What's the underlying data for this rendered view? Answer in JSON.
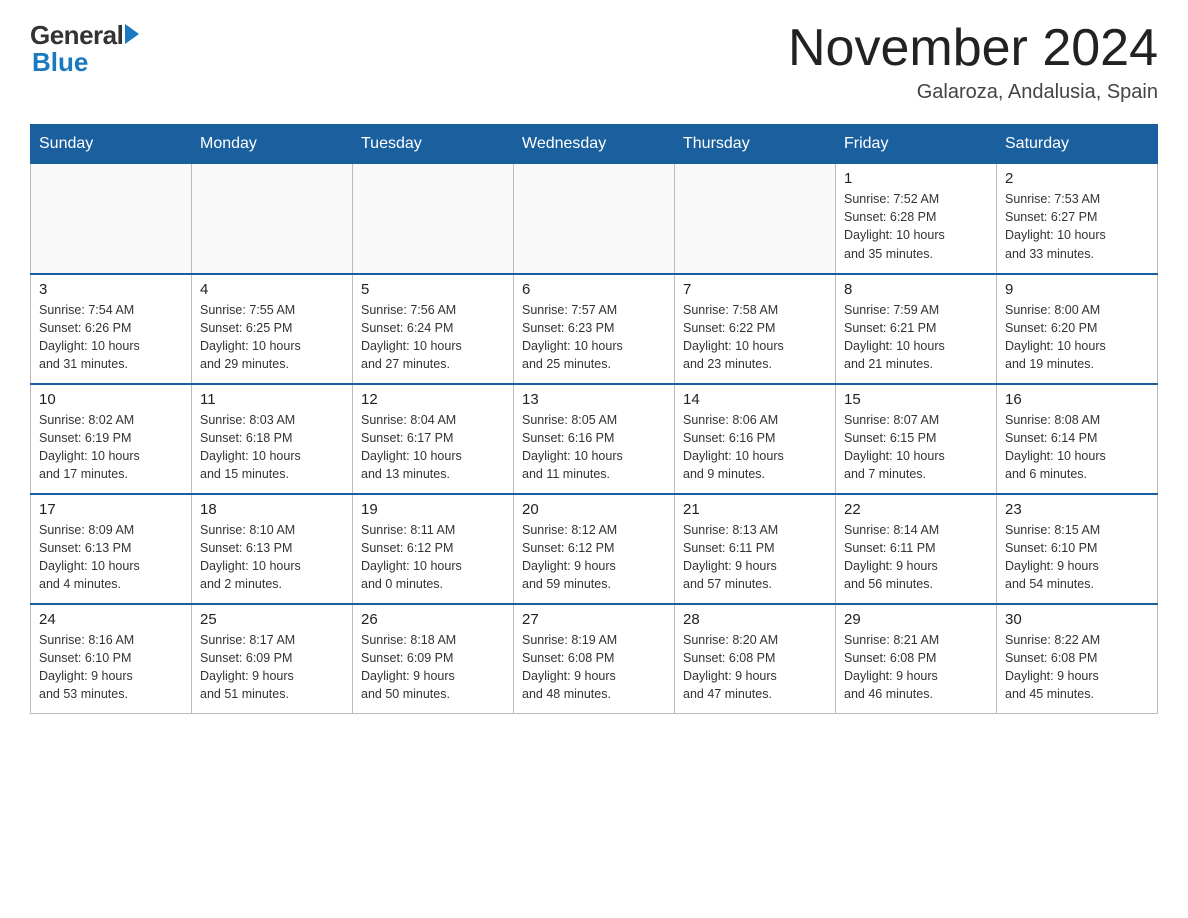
{
  "logo": {
    "general": "General",
    "blue": "Blue"
  },
  "header": {
    "title": "November 2024",
    "location": "Galaroza, Andalusia, Spain"
  },
  "days_of_week": [
    "Sunday",
    "Monday",
    "Tuesday",
    "Wednesday",
    "Thursday",
    "Friday",
    "Saturday"
  ],
  "weeks": [
    [
      {
        "day": "",
        "info": ""
      },
      {
        "day": "",
        "info": ""
      },
      {
        "day": "",
        "info": ""
      },
      {
        "day": "",
        "info": ""
      },
      {
        "day": "",
        "info": ""
      },
      {
        "day": "1",
        "info": "Sunrise: 7:52 AM\nSunset: 6:28 PM\nDaylight: 10 hours\nand 35 minutes."
      },
      {
        "day": "2",
        "info": "Sunrise: 7:53 AM\nSunset: 6:27 PM\nDaylight: 10 hours\nand 33 minutes."
      }
    ],
    [
      {
        "day": "3",
        "info": "Sunrise: 7:54 AM\nSunset: 6:26 PM\nDaylight: 10 hours\nand 31 minutes."
      },
      {
        "day": "4",
        "info": "Sunrise: 7:55 AM\nSunset: 6:25 PM\nDaylight: 10 hours\nand 29 minutes."
      },
      {
        "day": "5",
        "info": "Sunrise: 7:56 AM\nSunset: 6:24 PM\nDaylight: 10 hours\nand 27 minutes."
      },
      {
        "day": "6",
        "info": "Sunrise: 7:57 AM\nSunset: 6:23 PM\nDaylight: 10 hours\nand 25 minutes."
      },
      {
        "day": "7",
        "info": "Sunrise: 7:58 AM\nSunset: 6:22 PM\nDaylight: 10 hours\nand 23 minutes."
      },
      {
        "day": "8",
        "info": "Sunrise: 7:59 AM\nSunset: 6:21 PM\nDaylight: 10 hours\nand 21 minutes."
      },
      {
        "day": "9",
        "info": "Sunrise: 8:00 AM\nSunset: 6:20 PM\nDaylight: 10 hours\nand 19 minutes."
      }
    ],
    [
      {
        "day": "10",
        "info": "Sunrise: 8:02 AM\nSunset: 6:19 PM\nDaylight: 10 hours\nand 17 minutes."
      },
      {
        "day": "11",
        "info": "Sunrise: 8:03 AM\nSunset: 6:18 PM\nDaylight: 10 hours\nand 15 minutes."
      },
      {
        "day": "12",
        "info": "Sunrise: 8:04 AM\nSunset: 6:17 PM\nDaylight: 10 hours\nand 13 minutes."
      },
      {
        "day": "13",
        "info": "Sunrise: 8:05 AM\nSunset: 6:16 PM\nDaylight: 10 hours\nand 11 minutes."
      },
      {
        "day": "14",
        "info": "Sunrise: 8:06 AM\nSunset: 6:16 PM\nDaylight: 10 hours\nand 9 minutes."
      },
      {
        "day": "15",
        "info": "Sunrise: 8:07 AM\nSunset: 6:15 PM\nDaylight: 10 hours\nand 7 minutes."
      },
      {
        "day": "16",
        "info": "Sunrise: 8:08 AM\nSunset: 6:14 PM\nDaylight: 10 hours\nand 6 minutes."
      }
    ],
    [
      {
        "day": "17",
        "info": "Sunrise: 8:09 AM\nSunset: 6:13 PM\nDaylight: 10 hours\nand 4 minutes."
      },
      {
        "day": "18",
        "info": "Sunrise: 8:10 AM\nSunset: 6:13 PM\nDaylight: 10 hours\nand 2 minutes."
      },
      {
        "day": "19",
        "info": "Sunrise: 8:11 AM\nSunset: 6:12 PM\nDaylight: 10 hours\nand 0 minutes."
      },
      {
        "day": "20",
        "info": "Sunrise: 8:12 AM\nSunset: 6:12 PM\nDaylight: 9 hours\nand 59 minutes."
      },
      {
        "day": "21",
        "info": "Sunrise: 8:13 AM\nSunset: 6:11 PM\nDaylight: 9 hours\nand 57 minutes."
      },
      {
        "day": "22",
        "info": "Sunrise: 8:14 AM\nSunset: 6:11 PM\nDaylight: 9 hours\nand 56 minutes."
      },
      {
        "day": "23",
        "info": "Sunrise: 8:15 AM\nSunset: 6:10 PM\nDaylight: 9 hours\nand 54 minutes."
      }
    ],
    [
      {
        "day": "24",
        "info": "Sunrise: 8:16 AM\nSunset: 6:10 PM\nDaylight: 9 hours\nand 53 minutes."
      },
      {
        "day": "25",
        "info": "Sunrise: 8:17 AM\nSunset: 6:09 PM\nDaylight: 9 hours\nand 51 minutes."
      },
      {
        "day": "26",
        "info": "Sunrise: 8:18 AM\nSunset: 6:09 PM\nDaylight: 9 hours\nand 50 minutes."
      },
      {
        "day": "27",
        "info": "Sunrise: 8:19 AM\nSunset: 6:08 PM\nDaylight: 9 hours\nand 48 minutes."
      },
      {
        "day": "28",
        "info": "Sunrise: 8:20 AM\nSunset: 6:08 PM\nDaylight: 9 hours\nand 47 minutes."
      },
      {
        "day": "29",
        "info": "Sunrise: 8:21 AM\nSunset: 6:08 PM\nDaylight: 9 hours\nand 46 minutes."
      },
      {
        "day": "30",
        "info": "Sunrise: 8:22 AM\nSunset: 6:08 PM\nDaylight: 9 hours\nand 45 minutes."
      }
    ]
  ]
}
